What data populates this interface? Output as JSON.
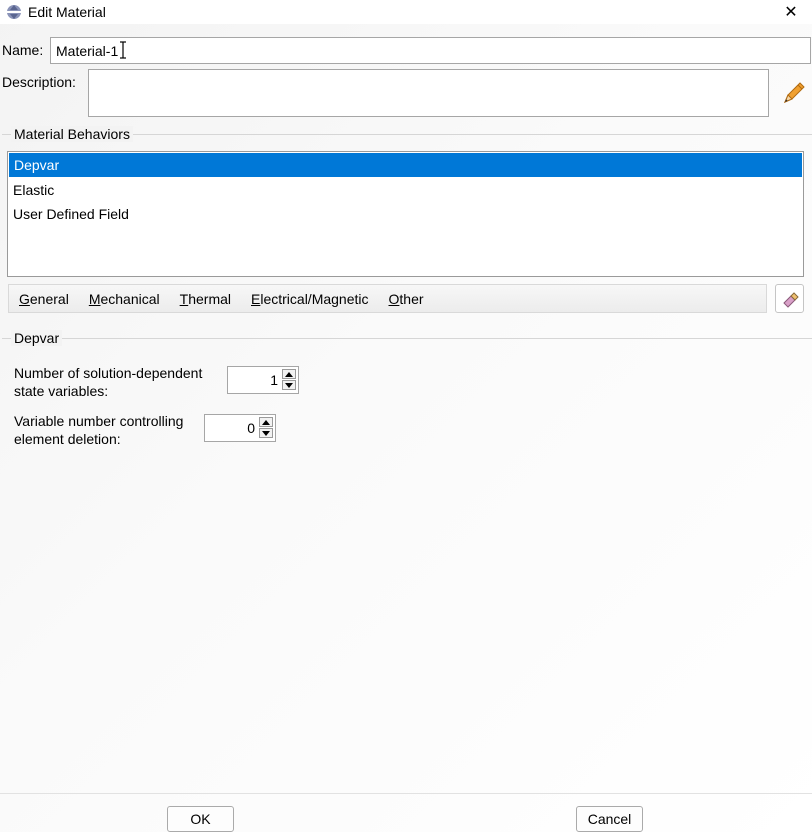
{
  "window": {
    "title": "Edit Material",
    "close_glyph": "✕"
  },
  "name": {
    "label": "Name:",
    "value": "Material-1"
  },
  "description": {
    "label": "Description:",
    "value": "",
    "edit_icon": "pencil-icon"
  },
  "behaviors": {
    "group_title": "Material Behaviors",
    "items": [
      "Depvar",
      "Elastic",
      "User Defined Field"
    ],
    "selected": "Depvar"
  },
  "menus": [
    {
      "first": "G",
      "rest": "eneral"
    },
    {
      "first": "M",
      "rest": "echanical"
    },
    {
      "first": "T",
      "rest": "hermal"
    },
    {
      "first": "E",
      "rest": "lectrical/Magnetic"
    },
    {
      "first": "O",
      "rest": "ther"
    }
  ],
  "depvar": {
    "group_title": "Depvar",
    "state_vars_label_1": "Number of solution-dependent",
    "state_vars_label_2": "state variables:",
    "state_vars_value": "1",
    "deletion_label_1": "Variable number controlling",
    "deletion_label_2": "element deletion:",
    "deletion_value": "0"
  },
  "buttons": {
    "ok": "OK",
    "cancel": "Cancel"
  },
  "colors": {
    "selection": "#0078d7",
    "pencil": "#f0a030"
  }
}
